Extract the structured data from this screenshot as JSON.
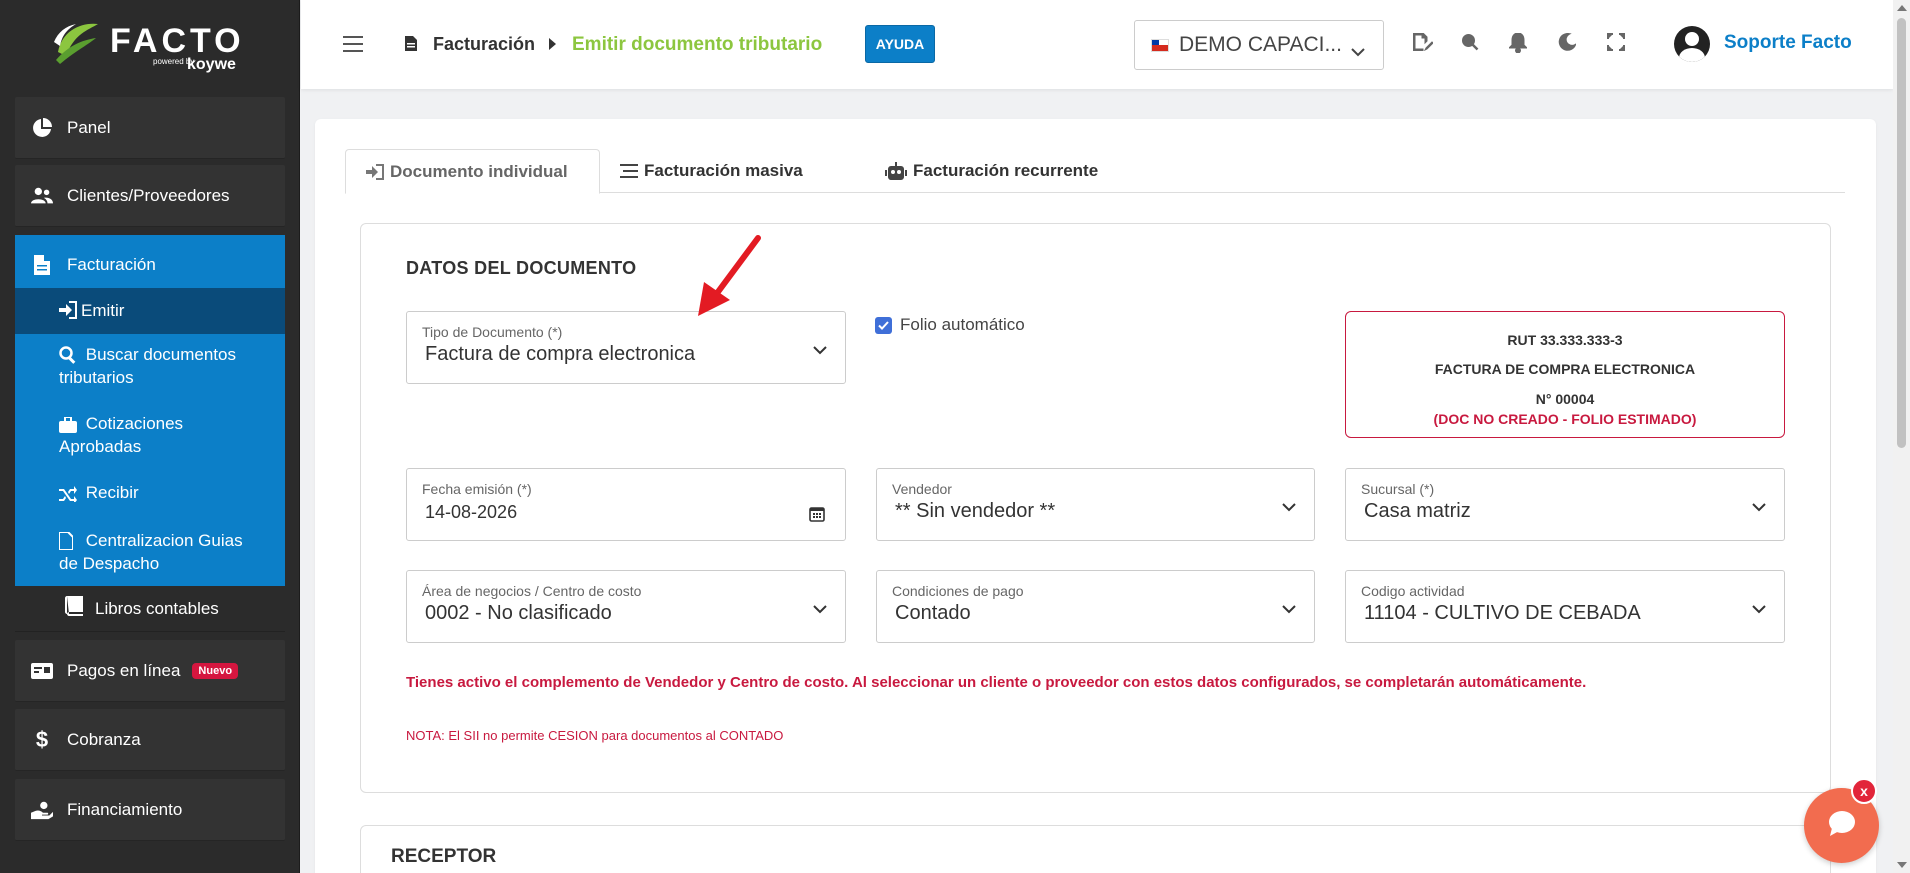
{
  "brand": {
    "name": "FACTO",
    "powered": "powered by",
    "partner": "koywe"
  },
  "sidebar": {
    "items": [
      {
        "label": "Panel"
      },
      {
        "label": "Clientes/Proveedores"
      },
      {
        "label": "Facturación"
      },
      {
        "label": "Pagos en línea",
        "badge": "Nuevo"
      },
      {
        "label": "Cobranza"
      },
      {
        "label": "Financiamiento"
      }
    ],
    "facturacion_sub": [
      {
        "label": "Emitir"
      },
      {
        "label": "Buscar documentos tributarios"
      },
      {
        "label": "Cotizaciones Aprobadas"
      },
      {
        "label": "Recibir"
      },
      {
        "label": "Centralizacion Guias de Despacho"
      },
      {
        "label": "Libros contables"
      }
    ]
  },
  "header": {
    "breadcrumb_root": "Facturación",
    "breadcrumb_current": "Emitir documento tributario",
    "help_label": "AYUDA",
    "company": "DEMO CAPACI...",
    "user": "Soporte Facto"
  },
  "tabs": [
    {
      "label": "Documento individual"
    },
    {
      "label": "Facturación masiva"
    },
    {
      "label": "Facturación recurrente"
    }
  ],
  "form": {
    "section_title": "DATOS DEL DOCUMENTO",
    "tipo_documento": {
      "label": "Tipo de Documento (*)",
      "value": "Factura de compra electronica"
    },
    "folio_automatico": {
      "label": "Folio automático",
      "checked": true
    },
    "fecha_emision": {
      "label": "Fecha emisión (*)",
      "value": "14-08-2026"
    },
    "vendedor": {
      "label": "Vendedor",
      "value": "** Sin vendedor **"
    },
    "sucursal": {
      "label": "Sucursal (*)",
      "value": "Casa matriz"
    },
    "area_negocios": {
      "label": "Área de negocios / Centro de costo",
      "value": "0002 - No clasificado"
    },
    "condiciones_pago": {
      "label": "Condiciones de pago",
      "value": "Contado"
    },
    "codigo_actividad": {
      "label": "Codigo actividad",
      "value": "11104 - CULTIVO DE CEBADA"
    },
    "info_message": "Tienes activo el complemento de Vendedor y Centro de costo. Al seleccionar un cliente o proveedor con estos datos configurados, se completarán automáticamente.",
    "nota": "NOTA: El SII no permite CESION para documentos al CONTADO"
  },
  "doc_summary": {
    "rut": "RUT 33.333.333-3",
    "type": "FACTURA DE COMPRA ELECTRONICA",
    "number": "N° 00004",
    "status": "(DOC NO CREADO - FOLIO ESTIMADO)"
  },
  "receptor": {
    "title": "RECEPTOR"
  },
  "chat": {
    "close_label": "x"
  },
  "colors": {
    "primary": "#0c7fc8",
    "accent_green": "#8cc63f",
    "danger": "#c8193f",
    "sidebar_bg": "#2b2b2b"
  }
}
